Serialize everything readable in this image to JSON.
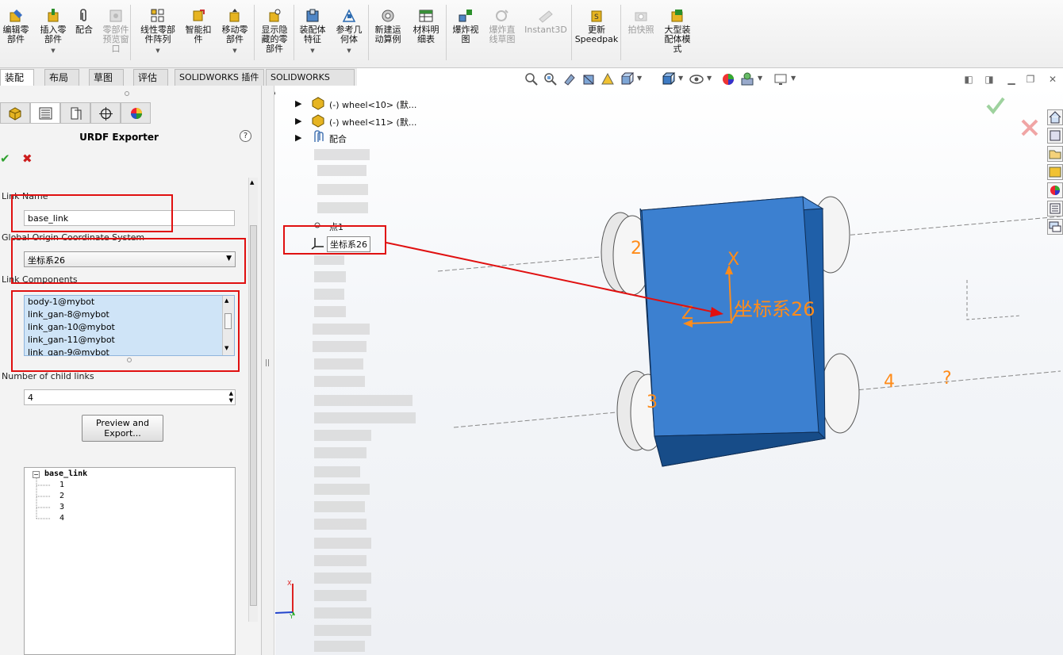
{
  "ribbon": {
    "buttons": [
      {
        "label": "编辑零\n部件",
        "caret": false,
        "disabled": false
      },
      {
        "label": "插入零\n部件",
        "caret": true,
        "disabled": false
      },
      {
        "label": "配合",
        "caret": false,
        "disabled": false
      },
      {
        "label": "零部件\n预览窗\n口",
        "caret": false,
        "disabled": true
      },
      {
        "label": "线性零部\n件阵列",
        "caret": true,
        "disabled": false
      },
      {
        "label": "智能扣\n件",
        "caret": false,
        "disabled": false
      },
      {
        "label": "移动零\n部件",
        "caret": true,
        "disabled": false
      },
      {
        "label": "显示隐\n藏的零\n部件",
        "caret": false,
        "disabled": false
      },
      {
        "label": "装配体\n特征",
        "caret": true,
        "disabled": false
      },
      {
        "label": "参考几\n何体",
        "caret": true,
        "disabled": false
      },
      {
        "label": "新建运\n动算例",
        "caret": false,
        "disabled": false
      },
      {
        "label": "材料明\n细表",
        "caret": false,
        "disabled": false
      },
      {
        "label": "爆炸视\n图",
        "caret": false,
        "disabled": false
      },
      {
        "label": "爆炸直\n线草图",
        "caret": false,
        "disabled": true
      },
      {
        "label": "Instant3D",
        "caret": false,
        "disabled": true
      },
      {
        "label": "更新\nSpeedpak",
        "caret": false,
        "disabled": false
      },
      {
        "label": "拍快照",
        "caret": false,
        "disabled": true
      },
      {
        "label": "大型装\n配体模\n式",
        "caret": false,
        "disabled": false
      }
    ]
  },
  "tabs": [
    "装配体",
    "布局",
    "草图",
    "评估",
    "SOLIDWORKS 插件",
    "SOLIDWORKS MBD"
  ],
  "property_manager": {
    "title": "URDF Exporter",
    "help": "?",
    "ok": "✔",
    "cancel": "✖",
    "link_name_label": "Link Name",
    "link_name_value": "base_link",
    "origin_label": "Global Origin Coordinate System",
    "origin_value": "坐标系26",
    "components_label": "Link Components",
    "components": [
      "body-1@mybot",
      "link_gan-8@mybot",
      "link_gan-10@mybot",
      "link_gan-11@mybot",
      "link_gan-9@mybot"
    ],
    "child_links_label": "Number of child links",
    "child_links_value": "4",
    "preview_button": "Preview and\nExport...",
    "tree_root": "base_link",
    "tree_children": [
      "1",
      "2",
      "3",
      "4"
    ]
  },
  "feature_tree": {
    "items": [
      "(-) wheel<10> (默...",
      "(-) wheel<11> (默...",
      "配合",
      "点1",
      "坐标系26"
    ]
  },
  "viewport": {
    "csys_label": "坐标系26",
    "axis_x": "X",
    "axis_z": "Z",
    "axis_y": "Y",
    "wheel_labels": [
      "2",
      "3",
      "4",
      "?"
    ]
  }
}
